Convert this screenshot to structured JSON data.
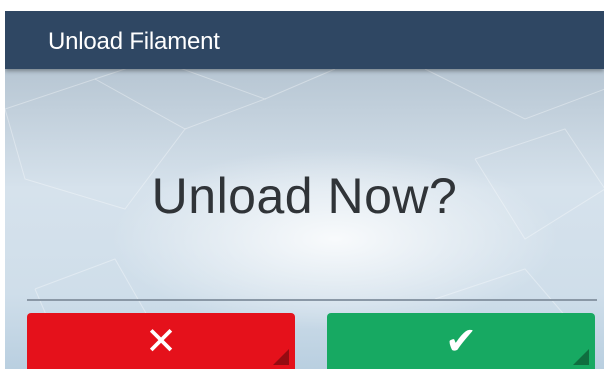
{
  "header": {
    "title": "Unload Filament"
  },
  "dialog": {
    "prompt": "Unload Now?"
  },
  "buttons": {
    "cancel": {
      "icon": "close-icon",
      "glyph": "✕",
      "color": "#e5111b"
    },
    "confirm": {
      "icon": "checkmark-icon",
      "glyph": "✔",
      "color": "#17a962"
    }
  },
  "colors": {
    "titlebar": "#2f4763",
    "prompt_text": "#303438"
  }
}
